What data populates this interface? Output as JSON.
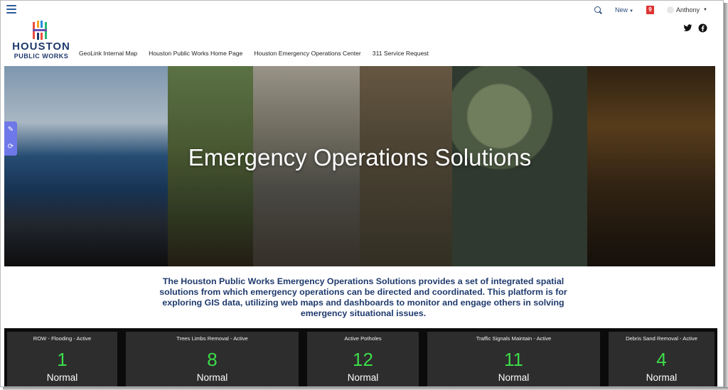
{
  "topbar": {
    "new_label": "New",
    "notification_count": "9",
    "user_name": "Anthony"
  },
  "logo": {
    "line1": "HOUSTON",
    "line2": "PUBLIC WORKS"
  },
  "nav": [
    {
      "label": "GeoLink Internal Map"
    },
    {
      "label": "Houston Public Works Home Page"
    },
    {
      "label": "Houston Emergency Operations Center"
    },
    {
      "label": "311 Service Request"
    }
  ],
  "hero": {
    "title": "Emergency Operations Solutions"
  },
  "intro": {
    "text": "The Houston Public Works Emergency Operations Solutions provides a set of integrated spatial solutions from which emergency operations can be directed and coordinated. This platform is for exploring GIS data, utilizing web maps and dashboards to monitor and engage others in solving emergency situational issues."
  },
  "stats": [
    {
      "label": "ROW - Flooding - Active",
      "value": "1",
      "status": "Normal"
    },
    {
      "label": "Trees Limbs Removal - Active",
      "value": "8",
      "status": "Normal"
    },
    {
      "label": "Active Potholes",
      "value": "12",
      "status": "Normal"
    },
    {
      "label": "Traffic Signals Maintain - Active",
      "value": "11",
      "status": "Normal"
    },
    {
      "label": "Debris Sand Removal - Active",
      "value": "4",
      "status": "Normal"
    }
  ],
  "colors": {
    "brand_navy": "#1f3a6d",
    "stat_value_green": "#3ddc4a",
    "notification_red": "#dd3333"
  }
}
